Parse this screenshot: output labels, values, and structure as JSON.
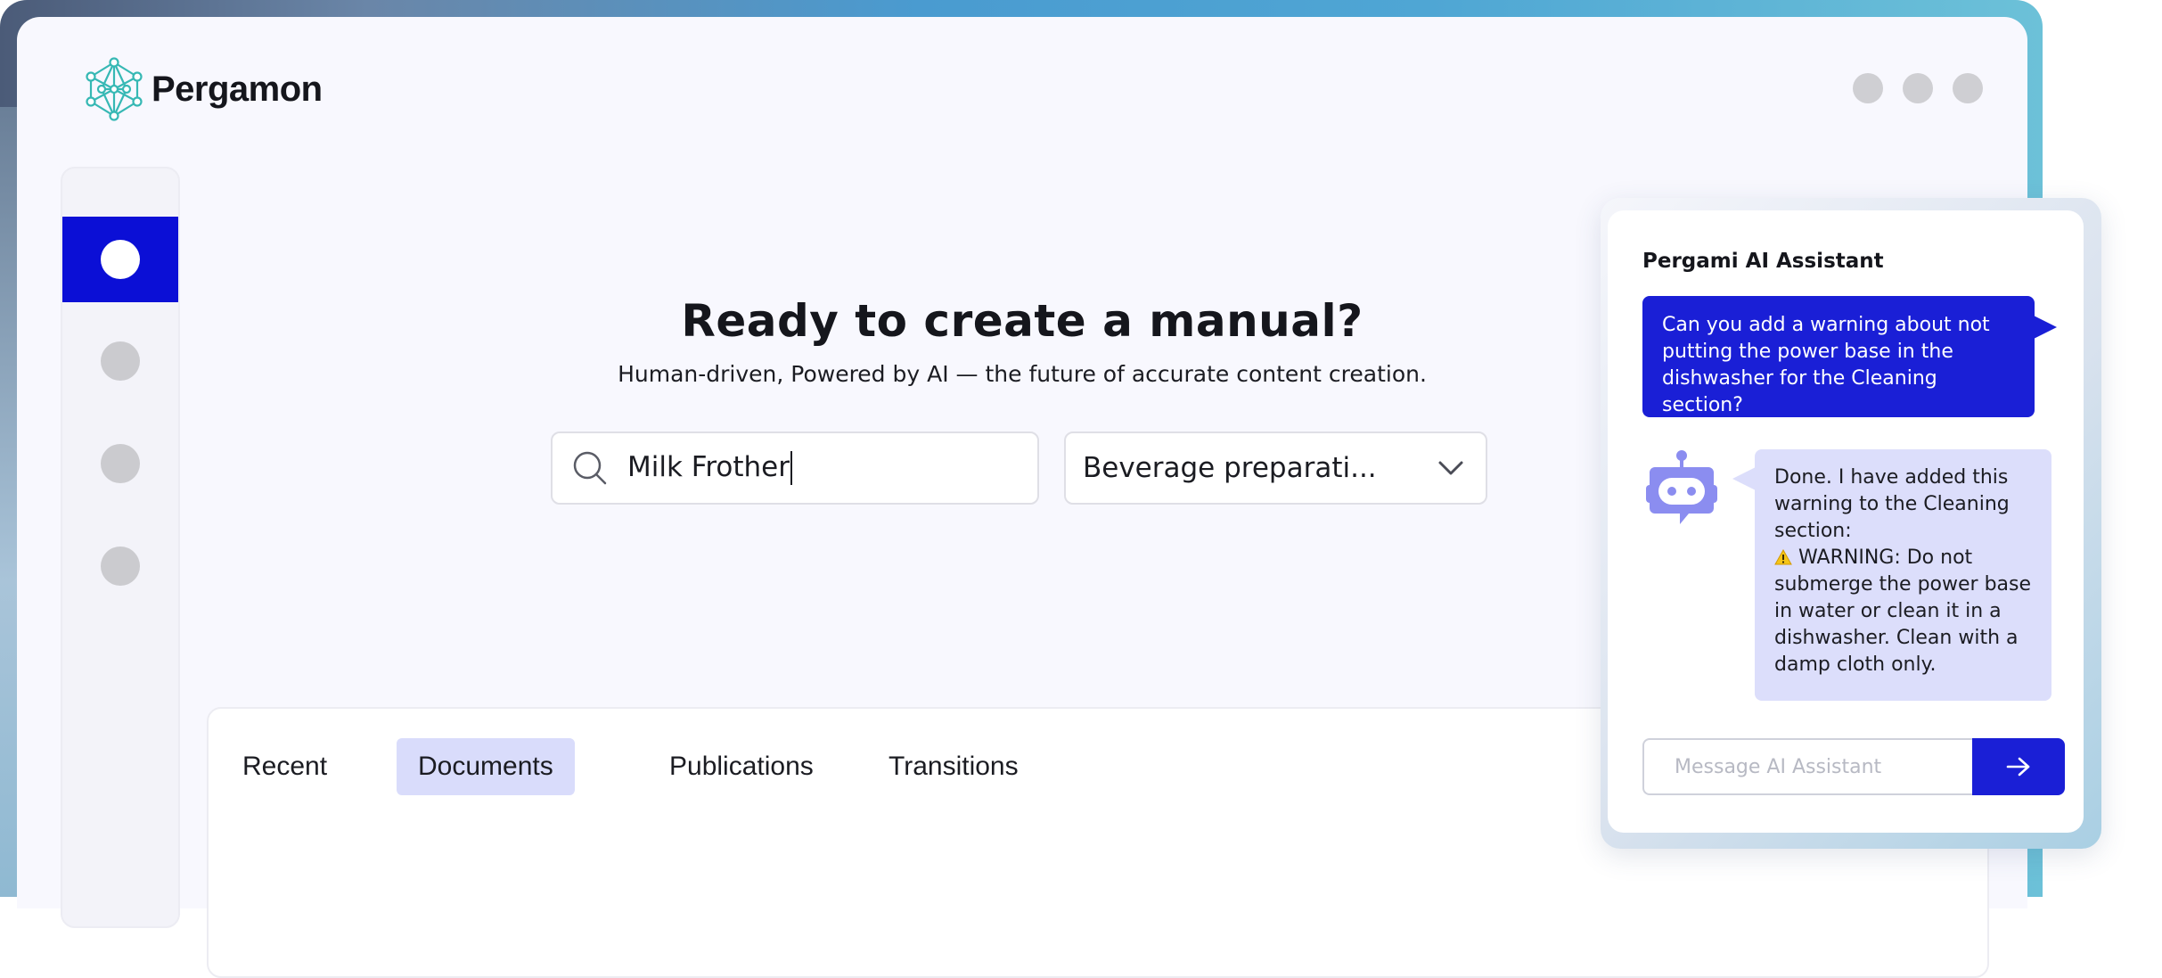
{
  "app": {
    "name": "Pergamon"
  },
  "colors": {
    "accent": "#0b0fd6",
    "assistant_blue": "#1a1fd6",
    "bot_bubble": "#dcdefb",
    "tab_active": "#d9dcfb"
  },
  "window_controls": [
    "window-dot",
    "window-dot",
    "window-dot"
  ],
  "sidebar": {
    "items": [
      {
        "name": "sidebar-item-1",
        "active": true
      },
      {
        "name": "sidebar-item-2",
        "active": false
      },
      {
        "name": "sidebar-item-3",
        "active": false
      },
      {
        "name": "sidebar-item-4",
        "active": false
      }
    ]
  },
  "hero": {
    "title": "Ready to create a manual?",
    "subtitle": "Human-driven, Powered by AI —  the future of accurate content creation."
  },
  "search": {
    "value": "Milk Frother",
    "icon": "search-icon"
  },
  "category_select": {
    "value": "Beverage preparati...",
    "icon": "chevron-down-icon"
  },
  "tabs": [
    {
      "label": "Recent",
      "active": false
    },
    {
      "label": "Documents",
      "active": true
    },
    {
      "label": "Publications",
      "active": false
    },
    {
      "label": "Transitions",
      "active": false
    }
  ],
  "assistant": {
    "title": "Pergami AI Assistant",
    "user_message": "Can you add a warning about not putting the power base in the dishwasher for the Cleaning section?",
    "bot_message_intro": "Done. I have added this warning to the Cleaning section:",
    "bot_message_warning": "WARNING: Do not submerge the power base in water or clean it in a dishwasher. Clean with a damp cloth only.",
    "input_placeholder": "Message AI Assistant",
    "send_icon": "arrow-right-icon",
    "avatar_icon": "robot-icon"
  }
}
